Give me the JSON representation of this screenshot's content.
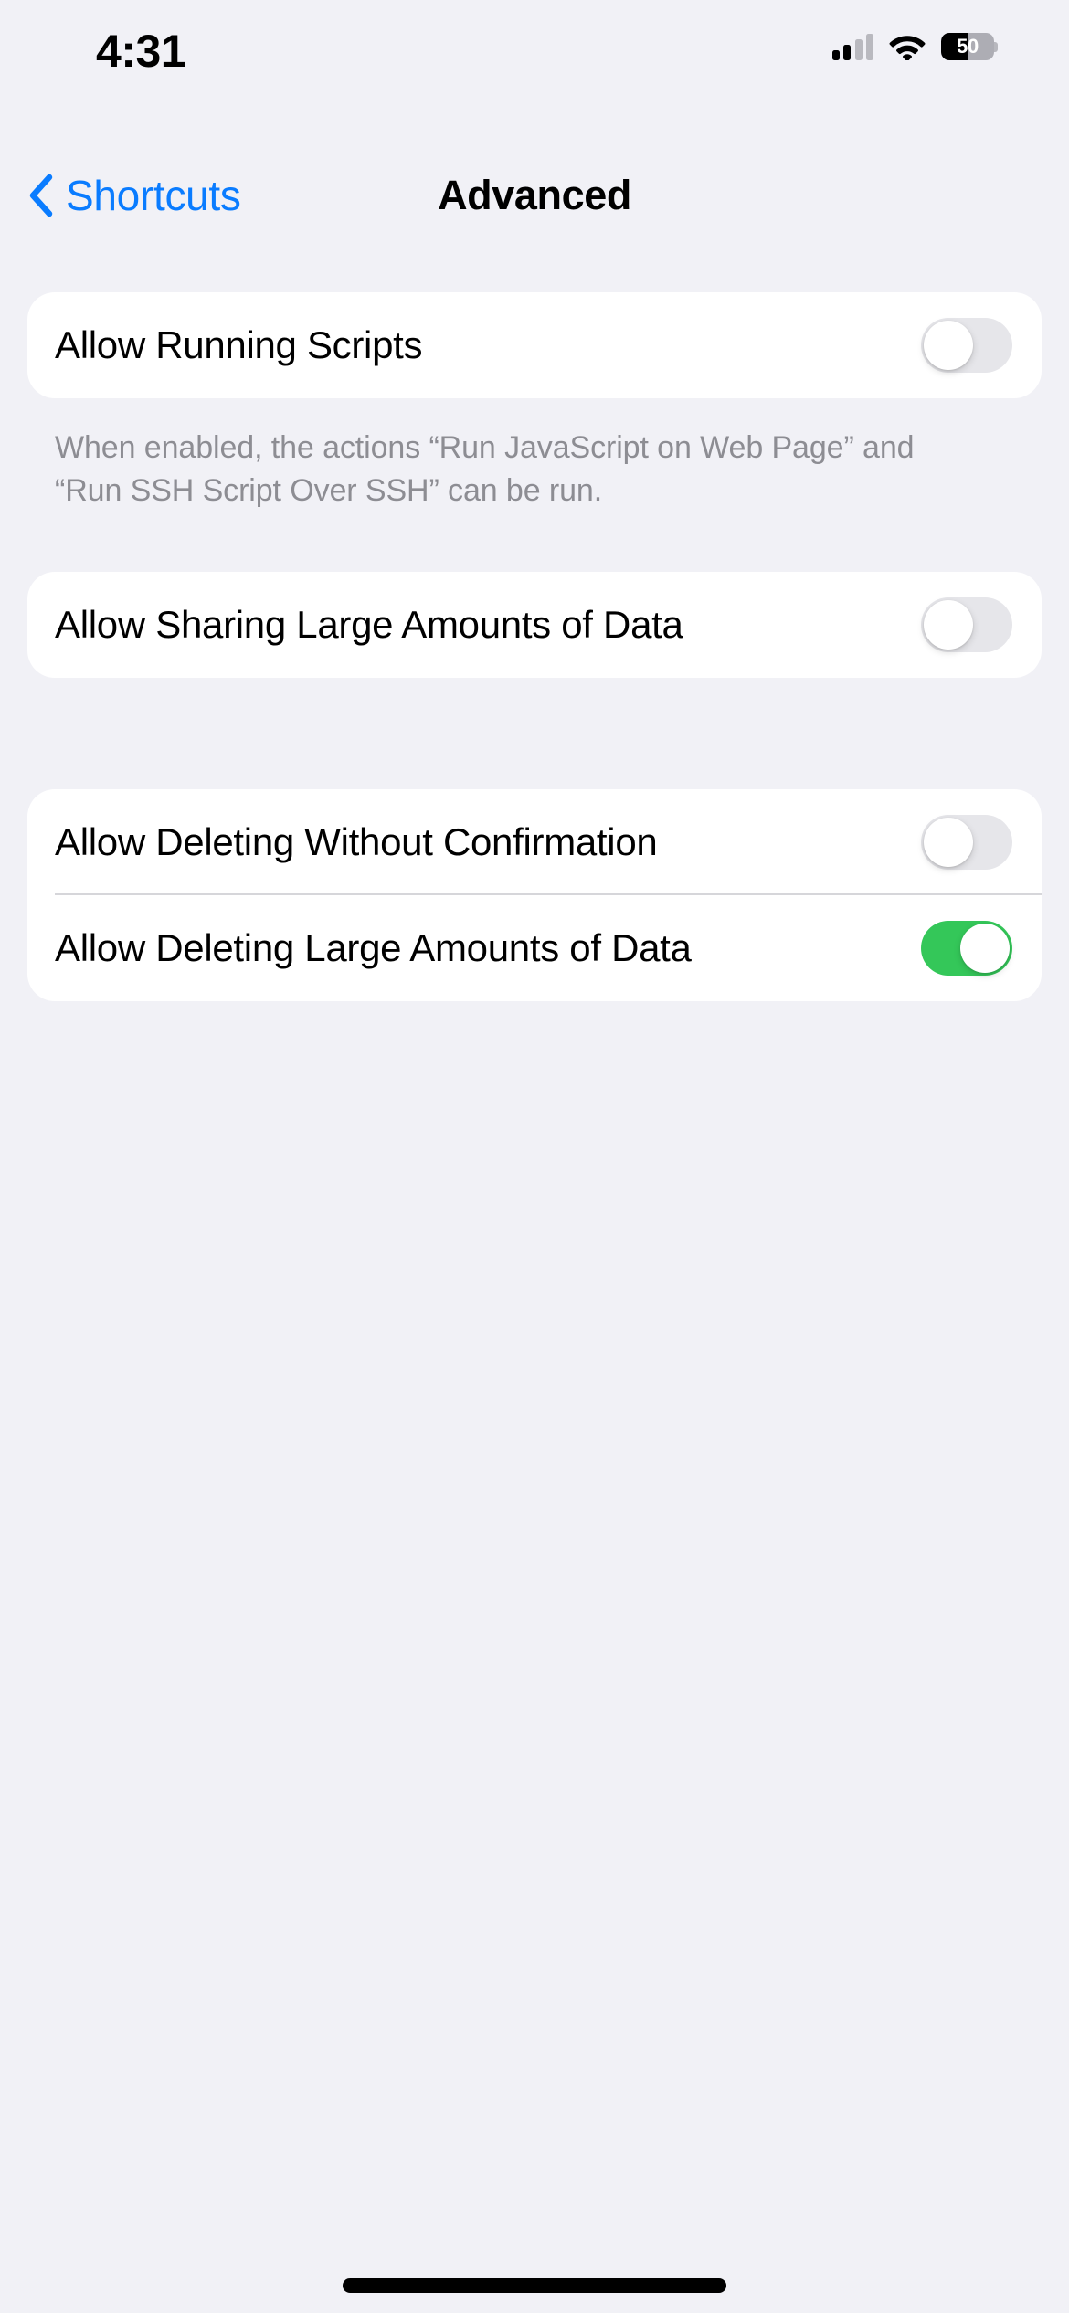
{
  "status_bar": {
    "time": "4:31",
    "cellular_icon": "cellular-bars-icon",
    "wifi_icon": "wifi-icon",
    "battery_icon": "battery-icon",
    "battery_percent": "50"
  },
  "nav_bar": {
    "back_icon": "chevron-left-icon",
    "back_label": "Shortcuts",
    "title": "Advanced"
  },
  "groups": [
    {
      "rows": [
        {
          "label": "Allow Running Scripts",
          "toggle": "off"
        }
      ],
      "footer": "When enabled, the actions “Run JavaScript on Web Page” and “Run SSH Script Over SSH” can be run."
    },
    {
      "rows": [
        {
          "label": "Allow Sharing Large Amounts of Data",
          "toggle": "off"
        }
      ],
      "footer": ""
    },
    {
      "rows": [
        {
          "label": "Allow Deleting Without Confirmation",
          "toggle": "off"
        },
        {
          "label": "Allow Deleting Large Amounts of Data",
          "toggle": "on"
        }
      ],
      "footer": ""
    }
  ],
  "colors": {
    "page_background": "#f1f1f6",
    "cell_background": "#ffffff",
    "accent_blue": "#0a7cff",
    "toggle_on_green": "#34c759",
    "toggle_off_gray": "#e6e6ea",
    "footer_text_gray": "#8d8d93"
  },
  "home_indicator": "home-indicator"
}
